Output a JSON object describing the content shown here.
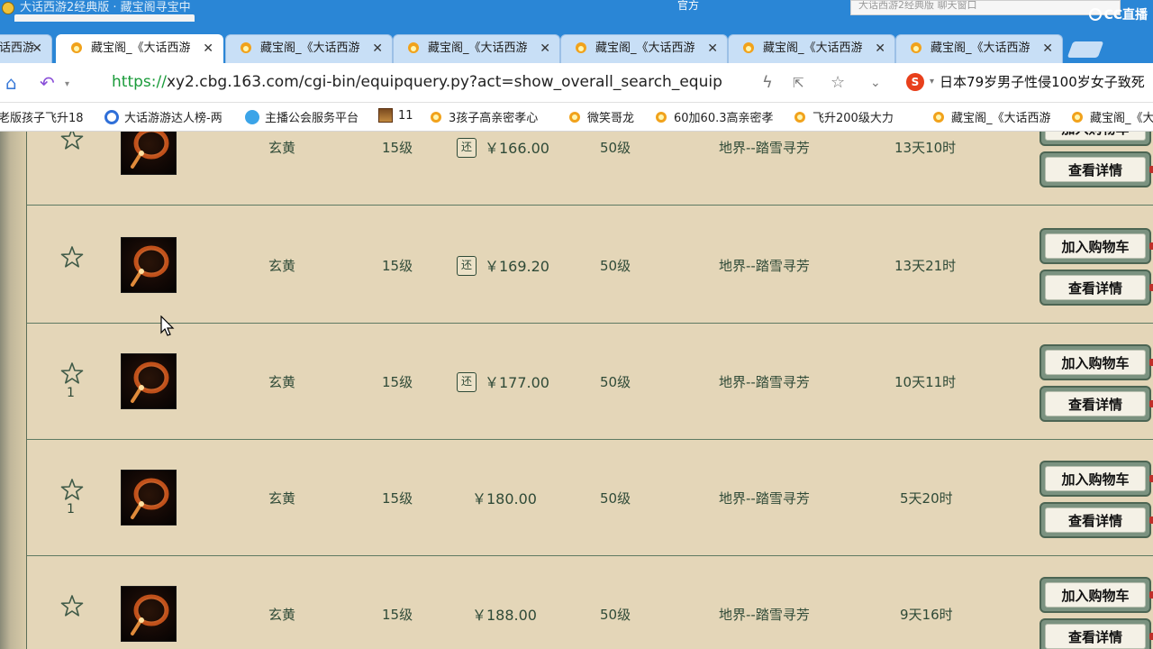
{
  "window": {
    "title": "大话西游2经典版  ·  藏宝阁寻宝中",
    "right_label": "官方",
    "search_placeholder": "大话西游2经典版  聊天窗口",
    "overlay_logo": "CC直播"
  },
  "tabs": [
    {
      "label": "话西游",
      "active": false
    },
    {
      "label": "藏宝阁_《大话西游",
      "active": true
    },
    {
      "label": "藏宝阁_《大话西游",
      "active": false
    },
    {
      "label": "藏宝阁_《大话西游",
      "active": false
    },
    {
      "label": "藏宝阁_《大话西游",
      "active": false
    },
    {
      "label": "藏宝阁_《大话西游",
      "active": false
    },
    {
      "label": "藏宝阁_《大话西游",
      "active": false
    }
  ],
  "address": {
    "scheme": "https://",
    "rest": "xy2.cbg.163.com/cgi-bin/equipquery.py?act=show_overall_search_equip",
    "news": "日本79岁男子性侵100岁女子致死"
  },
  "bookmarks": [
    {
      "label": "老版孩子飞升18",
      "icon": "none"
    },
    {
      "label": "大话游游达人榜-两",
      "icon": "cc"
    },
    {
      "label": "主播公会服务平台",
      "icon": "cloud"
    },
    {
      "label": "11",
      "icon": "game"
    },
    {
      "label": "3孩子高亲密孝心",
      "icon": "chick"
    },
    {
      "label": "微笑哥龙",
      "icon": "chick"
    },
    {
      "label": "60加60.3高亲密孝",
      "icon": "chick"
    },
    {
      "label": "飞升200级大力",
      "icon": "chick"
    },
    {
      "label": "藏宝阁_《大话西游",
      "icon": "chick"
    },
    {
      "label": "藏宝阁_《大",
      "icon": "chick"
    }
  ],
  "buttons": {
    "add_cart": "加入购物车",
    "details": "查看详情"
  },
  "rows": [
    {
      "star_count": "",
      "attr": "玄黄",
      "level": "15级",
      "has_return": true,
      "price": "￥166.00",
      "req_level": "50级",
      "server": "地界--踏雪寻芳",
      "time_left": "13天10时"
    },
    {
      "star_count": "",
      "attr": "玄黄",
      "level": "15级",
      "has_return": true,
      "price": "￥169.20",
      "req_level": "50级",
      "server": "地界--踏雪寻芳",
      "time_left": "13天21时"
    },
    {
      "star_count": "1",
      "attr": "玄黄",
      "level": "15级",
      "has_return": true,
      "price": "￥177.00",
      "req_level": "50级",
      "server": "地界--踏雪寻芳",
      "time_left": "10天11时"
    },
    {
      "star_count": "1",
      "attr": "玄黄",
      "level": "15级",
      "has_return": false,
      "price": "￥180.00",
      "req_level": "50级",
      "server": "地界--踏雪寻芳",
      "time_left": "5天20时"
    },
    {
      "star_count": "",
      "attr": "玄黄",
      "level": "15级",
      "has_return": false,
      "price": "￥188.00",
      "req_level": "50级",
      "server": "地界--踏雪寻芳",
      "time_left": "9天16时"
    }
  ],
  "icons": {
    "return_badge_text": "还",
    "star": "star-outline-icon",
    "equip": "ring-equipment-icon"
  }
}
